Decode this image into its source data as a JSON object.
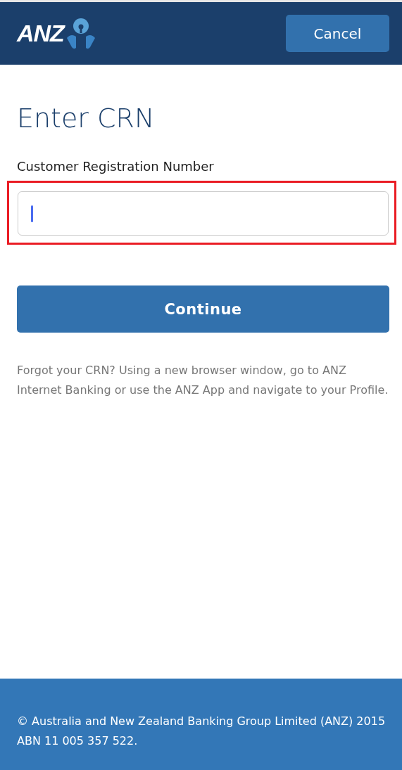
{
  "header": {
    "logo_text": "ANZ",
    "cancel_button": "Cancel"
  },
  "title": "Enter CRN",
  "field": {
    "label": "Customer Registration Number",
    "focused": true,
    "highlighted": true
  },
  "continue_button": "Continue",
  "help_text": "Forgot your CRN? Using a new browser window, go to ANZ Internet Banking or use the ANZ App and navigate to your Profile.",
  "footer": {
    "text": "© Australia and New Zealand Banking Group Limited (ANZ) 2015 ABN 11 005 357 522."
  }
}
